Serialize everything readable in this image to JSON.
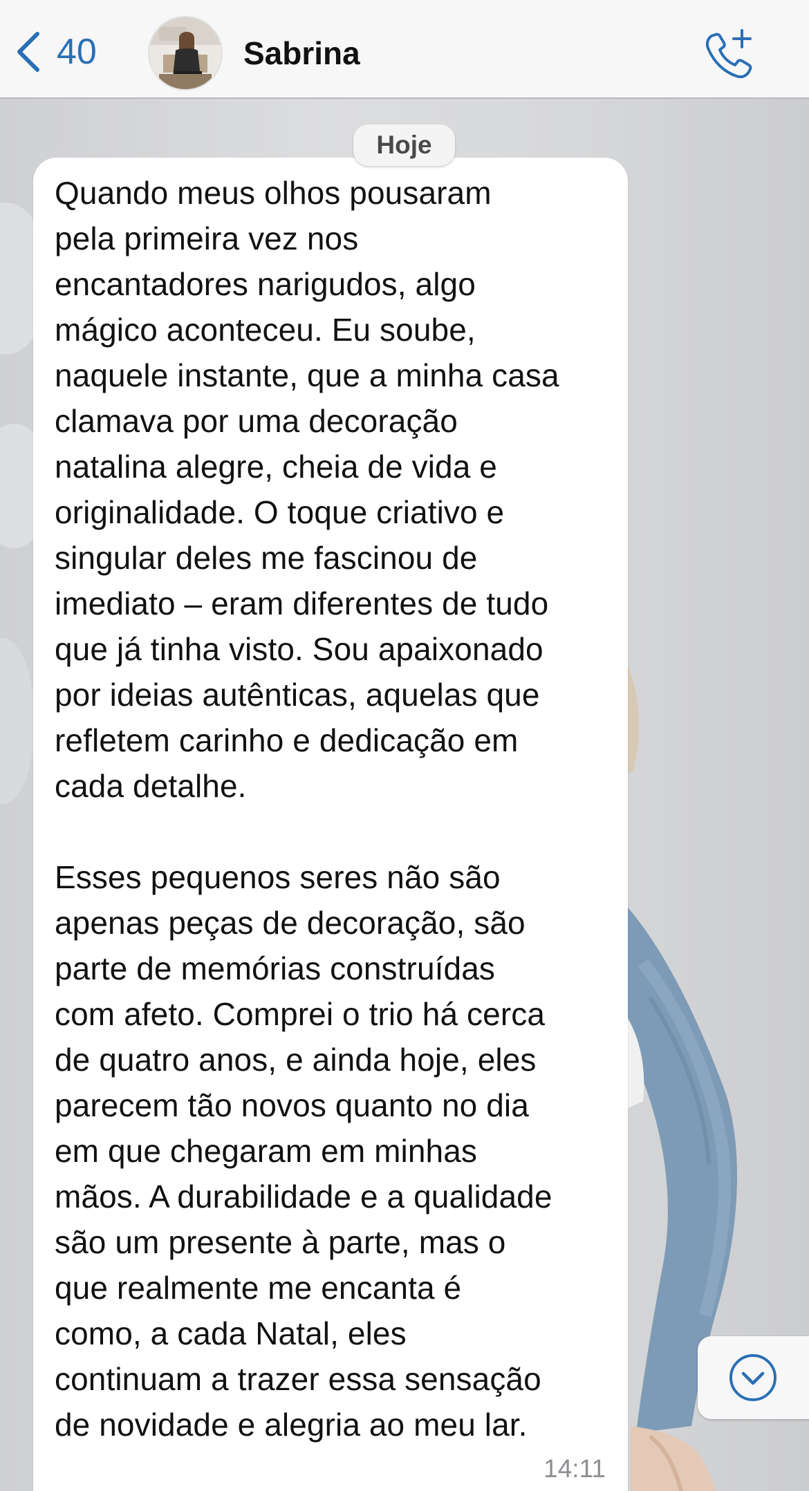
{
  "header": {
    "back_count": "40",
    "contact_name": "Sabrina"
  },
  "icons": {
    "back": "chevron-left-icon",
    "call": "phone-add-icon",
    "scroll_down": "chevron-down-circle-icon"
  },
  "colors": {
    "accent": "#2a6fb5",
    "header_bg": "#f7f7f8",
    "bubble_bg": "#ffffff",
    "timestamp": "#8e8e93"
  },
  "chat": {
    "date_label": "Hoje",
    "message": {
      "text": "Quando meus olhos pousaram\npela primeira vez nos\nencantadores narigudos, algo\nmágico aconteceu. Eu soube,\nnaquele instante, que a minha casa\nclamava por uma decoração\nnatalina alegre, cheia de vida e\noriginalidade. O toque criativo e\nsingular deles me fascinou de\nimediato – eram diferentes de tudo\nque já tinha visto. Sou apaixonado\npor ideias autênticas, aquelas que\nrefletem carinho e dedicação em\ncada detalhe.\n\nEsses pequenos seres não são\napenas peças de decoração, são\nparte de memórias construídas\ncom afeto. Comprei o trio há cerca\nde quatro anos, e ainda hoje, eles\nparecem tão novos quanto no dia\nem que chegaram em minhas\nmãos. A durabilidade e a qualidade\nsão um presente à parte, mas o\nque realmente me encanta é\ncomo, a cada Natal, eles\ncontinuam a trazer essa sensação\nde novidade e alegria ao meu lar.",
      "time": "14:11"
    }
  }
}
